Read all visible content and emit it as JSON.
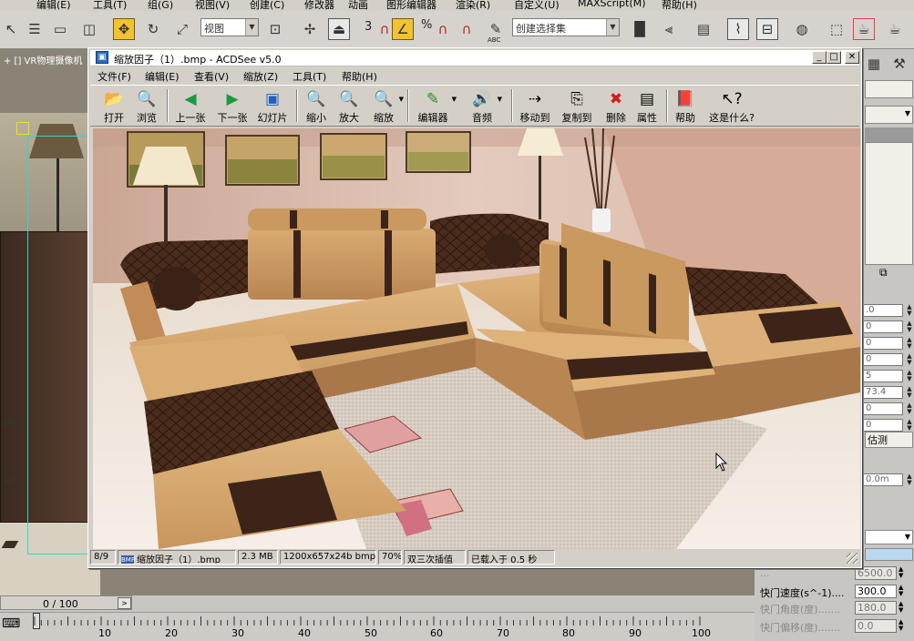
{
  "max": {
    "menus": [
      "编辑(E)",
      "工具(T)",
      "组(G)",
      "视图(V)",
      "创建(C)",
      "修改器",
      "动画",
      "图形编辑器",
      "渲染(R)",
      "自定义(U)",
      "MAXScript(M)",
      "帮助(H)"
    ],
    "toolbar": {
      "view_combo": "视图",
      "selection_set_combo": "创建选择集",
      "snap_label": "3",
      "percent_label": "%",
      "abc_label": "ABC"
    },
    "viewport_label": "+ [] VR物理摄像机",
    "right_panel": {
      "fields": [
        ".0",
        "0",
        "0",
        "0",
        "5",
        "73.4",
        "0",
        "0"
      ],
      "estimate_label": "估测",
      "distance_field": "0.0m"
    },
    "params": [
      {
        "label": "...",
        "value": "6500.0",
        "dim": true
      },
      {
        "label": "快门速度(s^-1)....",
        "value": "300.0",
        "dim": false
      },
      {
        "label": "快门角度(度).......",
        "value": "180.0",
        "dim": true
      },
      {
        "label": "快门偏移(度).......",
        "value": "0.0",
        "dim": true
      }
    ],
    "timeline": {
      "frame_counter": "0 / 100",
      "next_arrow": ">",
      "ticks": [
        "10",
        "20",
        "30",
        "40",
        "50",
        "60",
        "70",
        "80",
        "90",
        "100"
      ]
    }
  },
  "acdsee": {
    "title": "缩放因子（1）.bmp - ACDSee v5.0",
    "window_buttons": [
      "_",
      "□",
      "✕"
    ],
    "menus": [
      "文件(F)",
      "编辑(E)",
      "查看(V)",
      "缩放(Z)",
      "工具(T)",
      "帮助(H)"
    ],
    "tools": [
      {
        "label": "打开",
        "icon": "folder-open-icon",
        "glyph": "📂"
      },
      {
        "label": "浏览",
        "icon": "browse-icon",
        "glyph": "🔍"
      },
      {
        "label": "上一张",
        "icon": "previous-image-icon",
        "glyph": "◀"
      },
      {
        "label": "下一张",
        "icon": "next-image-icon",
        "glyph": "▶"
      },
      {
        "label": "幻灯片",
        "icon": "slideshow-icon",
        "glyph": "▣"
      },
      {
        "label": "缩小",
        "icon": "zoom-out-icon",
        "glyph": "🔍"
      },
      {
        "label": "放大",
        "icon": "zoom-in-icon",
        "glyph": "🔍"
      },
      {
        "label": "缩放",
        "icon": "zoom-icon",
        "glyph": "🔍"
      },
      {
        "label": "编辑器",
        "icon": "editor-icon",
        "glyph": "✎"
      },
      {
        "label": "音频",
        "icon": "audio-icon",
        "glyph": "🔊"
      },
      {
        "label": "移动到",
        "icon": "move-to-icon",
        "glyph": "⇢"
      },
      {
        "label": "复制到",
        "icon": "copy-to-icon",
        "glyph": "⎘"
      },
      {
        "label": "删除",
        "icon": "delete-icon",
        "glyph": "✖"
      },
      {
        "label": "属性",
        "icon": "properties-icon",
        "glyph": "▤"
      },
      {
        "label": "帮助",
        "icon": "help-book-icon",
        "glyph": "📕"
      },
      {
        "label": "这是什么?",
        "icon": "whats-this-icon",
        "glyph": "↖?"
      }
    ],
    "status": {
      "index": "8/9",
      "filename": "缩放因子（1）.bmp",
      "size": "2.3 MB",
      "dimensions": "1200x657x24b bmp",
      "zoom": "70%",
      "interpolation": "双三次插值",
      "load_time": "已载入于 0.5 秒"
    }
  },
  "colors": {
    "max_toolbar": "#d6d3ce",
    "acd_face": "#d4d0c8",
    "active_tool": "#f1c232",
    "sofa_tan": "#c9995f",
    "sofa_brown": "#3c2418"
  }
}
